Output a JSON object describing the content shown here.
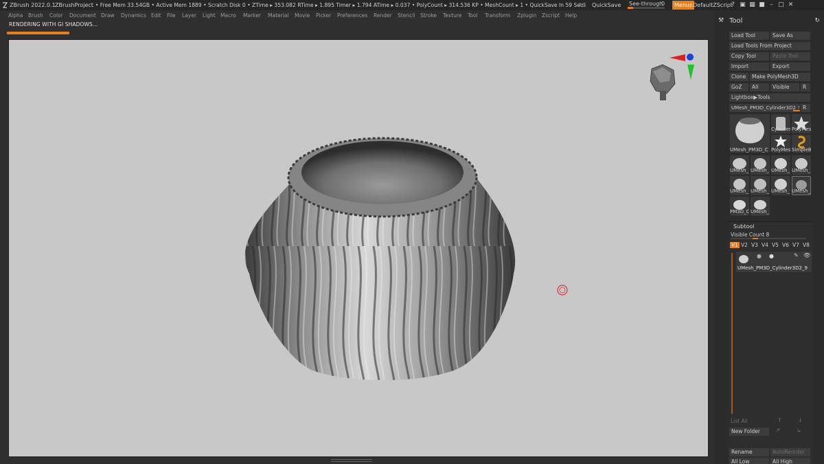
{
  "titlebar": {
    "app": "ZBrush 2022.0.1",
    "project": "ZBrushProject",
    "stats": ". • Free Mem 33.54GB • Active Mem 1889 • Scratch Disk 0 • ZTime ▸ 353.082 RTime ▸ 1.895 Timer ▸ 1.794 ATime ▸ 0.037 • PolyCount ▸ 314.536 KP • MeshCount ▸ 1 • QuickSave In 59 Secs",
    "ac": "AC",
    "quicksave": "QuickSave",
    "see_through_label": "See-through",
    "see_through_value": "0",
    "see_through_fraction": 0.15,
    "menus": "Menus",
    "default_zscript": "DefaultZScript"
  },
  "menubar": [
    "Alpha",
    "Brush",
    "Color",
    "Document",
    "Draw",
    "Dynamics",
    "Edit",
    "File",
    "Layer",
    "Light",
    "Macro",
    "Marker",
    "Material",
    "Movie",
    "Picker",
    "Preferences",
    "Render",
    "Stencil",
    "Stroke",
    "Texture",
    "Tool",
    "Transform",
    "Zplugin",
    "Zscript",
    "Help"
  ],
  "status": {
    "message": "RENDERING WITH GI SHADOWS...",
    "progress_fraction": 0.08
  },
  "panel": {
    "title": "Tool",
    "buttons": {
      "load_tool": "Load Tool",
      "save_as": "Save As",
      "load_from_project": "Load Tools From Project",
      "copy_tool": "Copy Tool",
      "paste_tool": "Paste Tool",
      "import": "Import",
      "export": "Export",
      "clone": "Clone",
      "make_polymesh": "Make PolyMesh3D",
      "goz": "GoZ",
      "all": "All",
      "visible": "Visible",
      "r": "R",
      "lightbox_tools": "Lightbox▶Tools",
      "current_tool": "UMesh_PM3D_Cylinder3D2_9",
      "r2": "R"
    },
    "thumbs": {
      "main_label": "UMesh_PM3D_C",
      "cylinder": "Cylinder",
      "polymesh_a": "PolyMes",
      "polymesh_b": "PolyMes",
      "simple": "SimpleB",
      "grid": [
        "UMesh_",
        "UMesh_",
        "UMesh_",
        "UMesh_",
        "UMesh_",
        "UMesh_",
        "UMesh_",
        "UMesh_",
        "PM3D_C",
        "UMesh_"
      ]
    },
    "subtool": {
      "title": "Subtool",
      "visible_count": "Visible Count 8",
      "tabs": [
        "V1",
        "V2",
        "V3",
        "V4",
        "V5",
        "V6",
        "V7",
        "V8"
      ],
      "item_name": "UMesh_PM3D_Cylinder3D2_9",
      "list_all": "List All",
      "new_folder": "New Folder",
      "rename": "Rename",
      "autoreorder": "AutoReorder",
      "all_low": "All Low",
      "all_high": "All High"
    }
  }
}
